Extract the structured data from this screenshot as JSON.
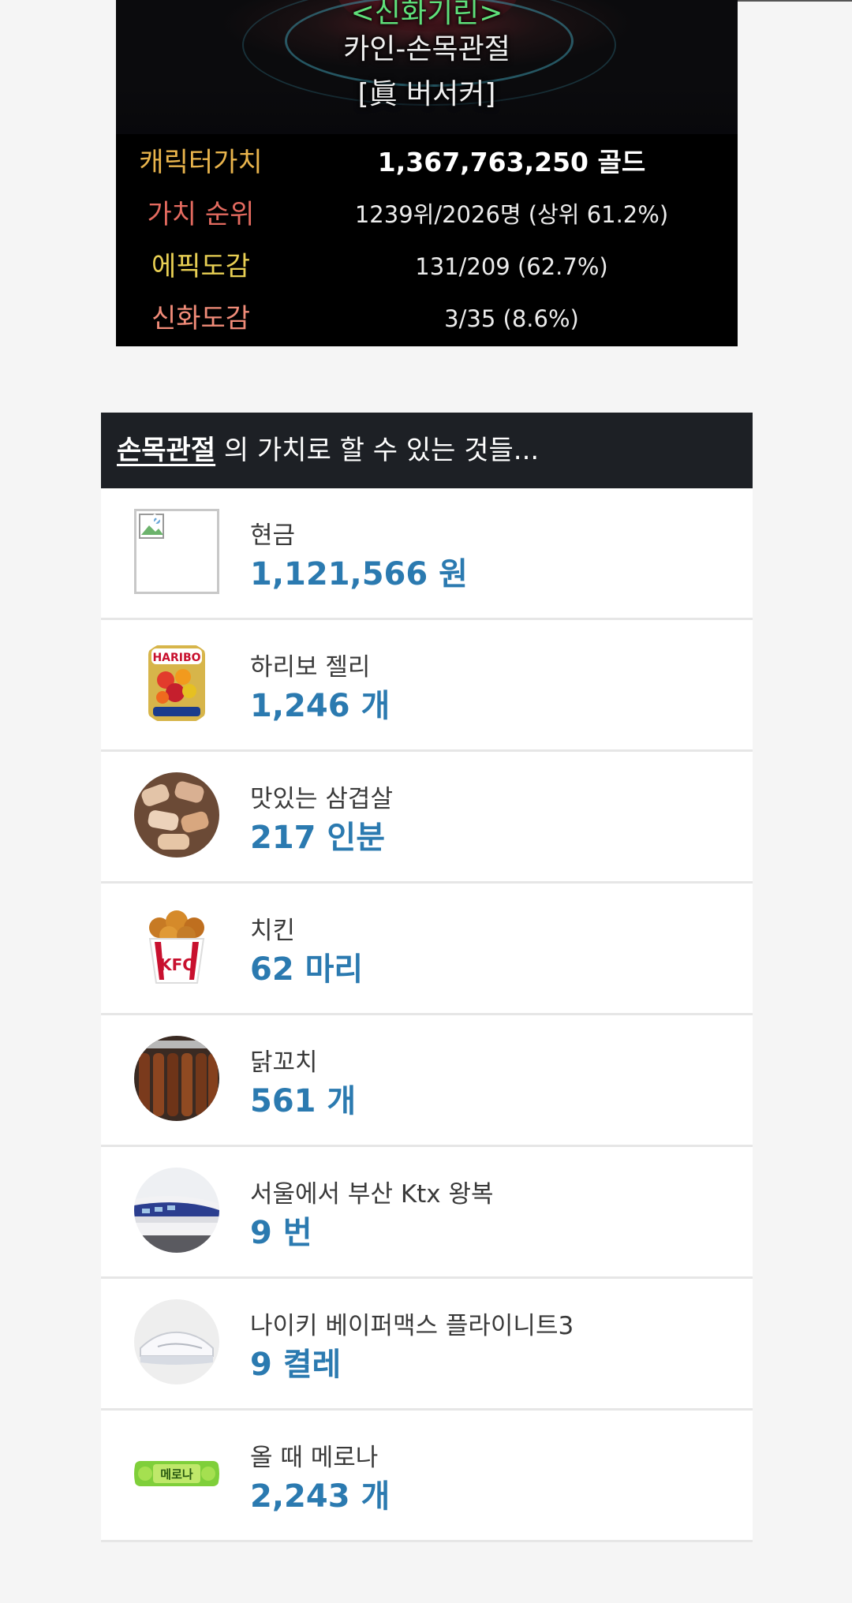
{
  "character": {
    "title_tag": "<신화기린>",
    "server_name": "카인-손목관절",
    "class": "[眞 버서커]"
  },
  "stats": [
    {
      "label": "캐릭터가치",
      "value": "1,367,763,250 골드",
      "label_color": "#e9b44c"
    },
    {
      "label": "가치 순위",
      "value": "1239위/2026명 (상위 61.2%)",
      "label_color": "#e36a5f"
    },
    {
      "label": "에픽도감",
      "value": "131/209 (62.7%)",
      "label_color": "#e8cf53"
    },
    {
      "label": "신화도감",
      "value": "3/35 (8.6%)",
      "label_color": "#f08b78"
    }
  ],
  "worth": {
    "name": "손목관절",
    "suffix": " 의 가치로 할 수 있는 것들...",
    "items": [
      {
        "label": "현금",
        "value": "1,121,566 원",
        "icon": "broken-image-icon"
      },
      {
        "label": "하리보 젤리",
        "value": "1,246 개",
        "icon": "haribo-icon"
      },
      {
        "label": "맛있는 삼겹살",
        "value": "217 인분",
        "icon": "samgyeopsal-icon"
      },
      {
        "label": "치킨",
        "value": "62 마리",
        "icon": "chicken-icon"
      },
      {
        "label": "닭꼬치",
        "value": "561 개",
        "icon": "chicken-skewer-icon"
      },
      {
        "label": "서울에서 부산 Ktx 왕복",
        "value": "9 번",
        "icon": "ktx-train-icon"
      },
      {
        "label": "나이키 베이퍼맥스 플라이니트3",
        "value": "9 켤레",
        "icon": "nike-shoe-icon"
      },
      {
        "label": "올 때 메로나",
        "value": "2,243 개",
        "icon": "melona-icon",
        "icon_text": "메로나"
      }
    ]
  },
  "colors": {
    "accent_value": "#2b7ab0",
    "header_bg": "#1d2025",
    "title_green": "#5fe07a"
  }
}
